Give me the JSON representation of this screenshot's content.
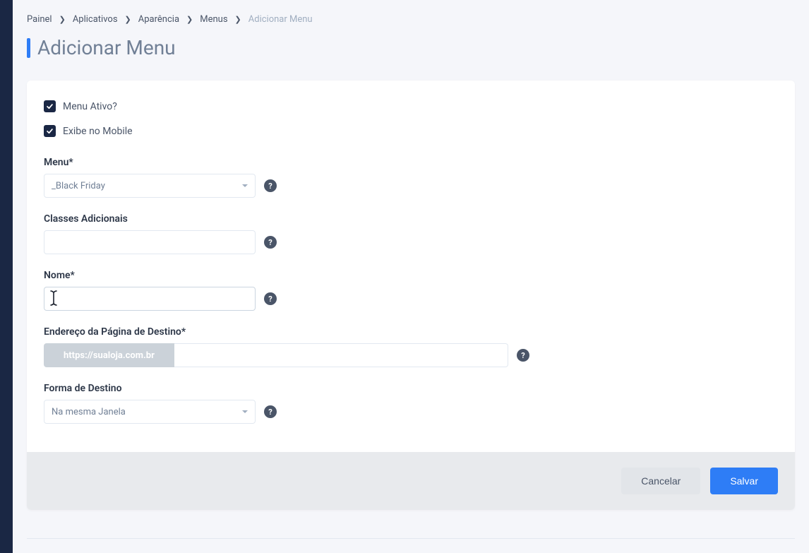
{
  "breadcrumb": {
    "items": [
      {
        "label": "Painel"
      },
      {
        "label": "Aplicativos"
      },
      {
        "label": "Aparência"
      },
      {
        "label": "Menus"
      }
    ],
    "current": "Adicionar Menu"
  },
  "page": {
    "title": "Adicionar Menu"
  },
  "form": {
    "active": {
      "label": "Menu Ativo?",
      "checked": true
    },
    "mobile": {
      "label": "Exibe no Mobile",
      "checked": true
    },
    "menu": {
      "label": "Menu*",
      "value": "_Black Friday"
    },
    "classes": {
      "label": "Classes Adicionais",
      "value": ""
    },
    "name": {
      "label": "Nome*",
      "value": ""
    },
    "url": {
      "label": "Endereço da Página de Destino*",
      "prefix": "https://sualoja.com.br",
      "value": ""
    },
    "target": {
      "label": "Forma de Destino",
      "value": "Na mesma Janela"
    }
  },
  "buttons": {
    "cancel": "Cancelar",
    "save": "Salvar"
  },
  "help_glyph": "?"
}
